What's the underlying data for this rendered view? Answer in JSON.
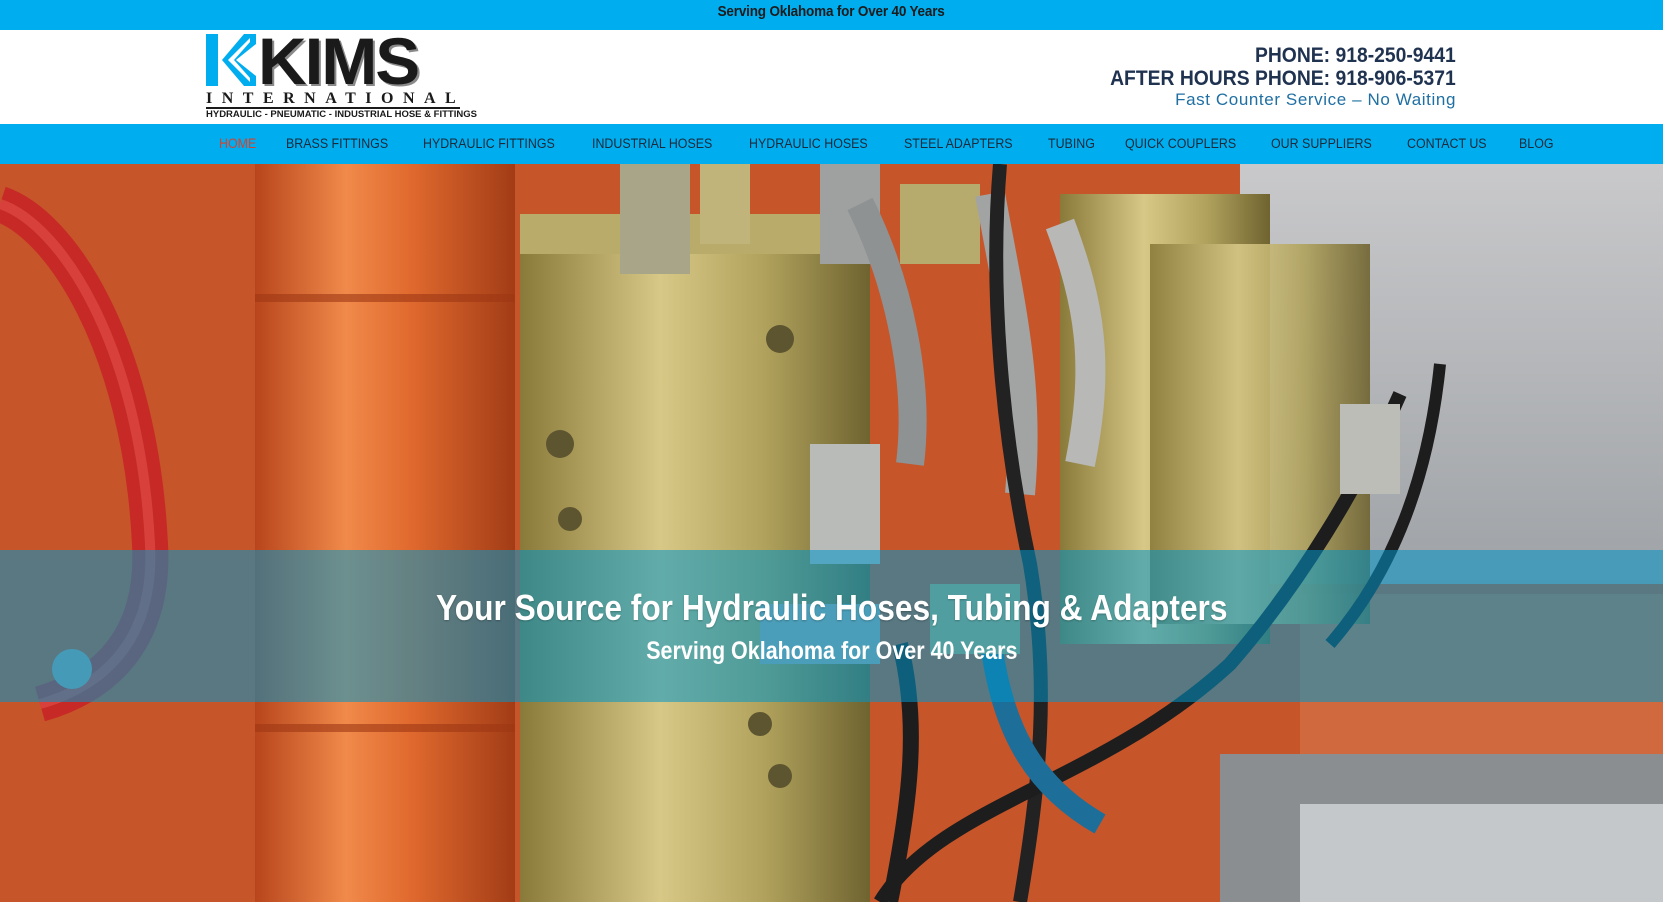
{
  "topbar": {
    "text": "Serving Oklahoma for Over 40 Years"
  },
  "logo": {
    "name": "KIMS",
    "subtitle": "INTERNATIONAL",
    "tagline": "HYDRAULIC - PNEUMATIC - INDUSTRIAL HOSE & FITTINGS"
  },
  "contact": {
    "phone": "PHONE: 918-250-9441",
    "after_hours": "AFTER HOURS PHONE: 918-906-5371",
    "service": "Fast Counter Service – No Waiting"
  },
  "nav": {
    "items": [
      {
        "label": "HOME",
        "active": true
      },
      {
        "label": "BRASS FITTINGS"
      },
      {
        "label": "HYDRAULIC FITTINGS"
      },
      {
        "label": "INDUSTRIAL HOSES"
      },
      {
        "label": "HYDRAULIC HOSES"
      },
      {
        "label": "STEEL ADAPTERS"
      },
      {
        "label": "TUBING"
      },
      {
        "label": "QUICK COUPLERS"
      },
      {
        "label": "OUR SUPPLIERS"
      },
      {
        "label": "CONTACT US"
      },
      {
        "label": "BLOG"
      }
    ]
  },
  "hero": {
    "title": "Your Source for Hydraulic Hoses, Tubing & Adapters",
    "subtitle": "Serving Oklahoma for Over 40 Years"
  },
  "colors": {
    "accent": "#00adef",
    "nav_active": "#d8412a",
    "phone_text": "#1f3250",
    "service_text": "#1f6fa3"
  }
}
